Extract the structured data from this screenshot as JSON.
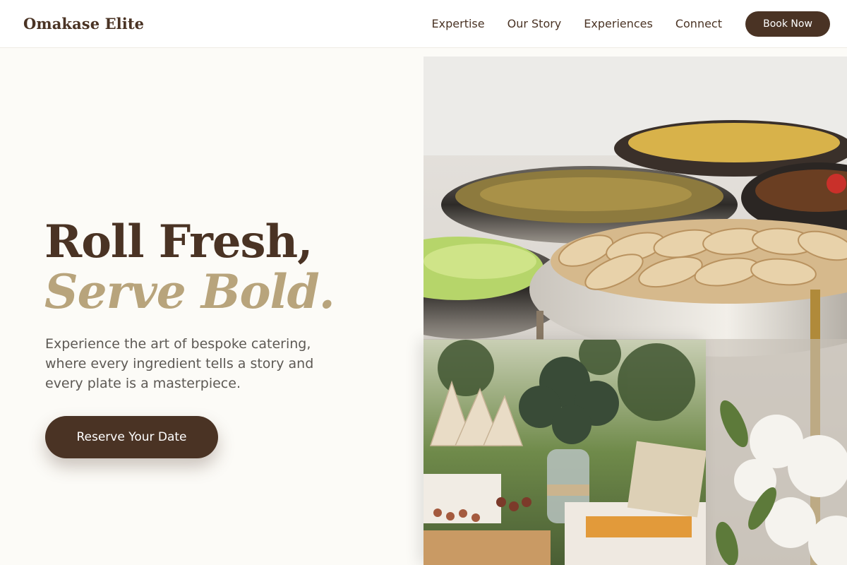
{
  "header": {
    "logo": "Omakase Elite",
    "nav": [
      "Expertise",
      "Our Story",
      "Experiences",
      "Connect"
    ],
    "cta": "Book Now"
  },
  "hero": {
    "title_line1": "Roll Fresh,",
    "title_line2": "Serve Bold.",
    "subtitle": "Experience the art of bespoke catering, where every ingredient tells a story and every plate is a masterpiece.",
    "cta": "Reserve Your Date"
  },
  "images": {
    "main": "catering buffet with chafing dishes of wraps, salad and food",
    "secondary": "outdoor table with flower vase, paper cones and snack trays"
  },
  "colors": {
    "brand_dark": "#4a3324",
    "accent_gold": "#b8a47c",
    "page_bg": "#fcfbf7",
    "text_muted": "#5d5954"
  }
}
